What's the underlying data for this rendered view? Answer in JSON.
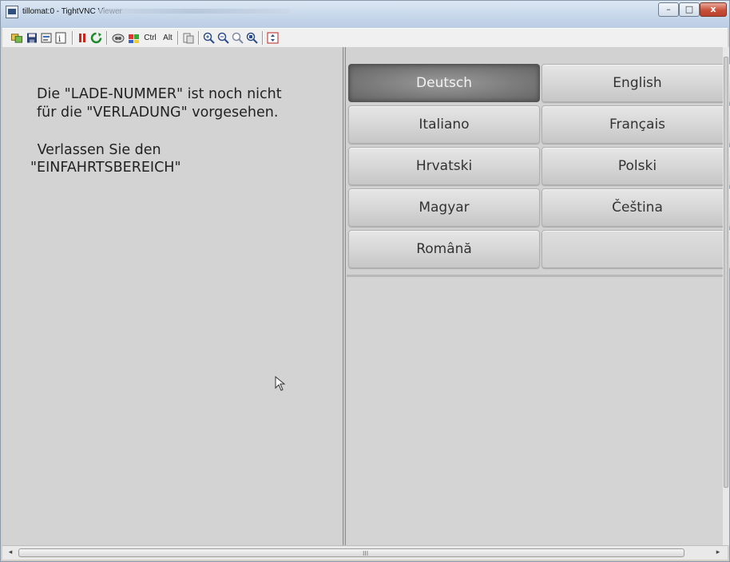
{
  "window": {
    "title": "tillomat:0 - TightVNC Viewer",
    "minimize_glyph": "–",
    "maximize_glyph": "□",
    "close_glyph": "x"
  },
  "toolbar": {
    "ctrl_label": "Ctrl",
    "alt_label": "Alt"
  },
  "message": {
    "line1": "Die \"LADE-NUMMER\" ist noch nicht",
    "line2": "für die \"VERLADUNG\" vorgesehen.",
    "line3": " Verlassen Sie den",
    "line4": "\"EINFAHRTSBEREICH\""
  },
  "languages": [
    {
      "label": "Deutsch",
      "selected": true
    },
    {
      "label": "English",
      "selected": false
    },
    {
      "label": "Italiano",
      "selected": false
    },
    {
      "label": "Français",
      "selected": false
    },
    {
      "label": "Hrvatski",
      "selected": false
    },
    {
      "label": "Polski",
      "selected": false
    },
    {
      "label": "Magyar",
      "selected": false
    },
    {
      "label": "Čeština",
      "selected": false
    },
    {
      "label": "Română",
      "selected": false
    },
    {
      "label": "",
      "selected": false
    }
  ],
  "scrollbar": {
    "left_arrow": "◂",
    "right_arrow": "▸",
    "grip": "III"
  },
  "colors": {
    "selected_button": "#7b7b7b",
    "button": "#d7d7d7",
    "panel": "#d3d3d3",
    "title_bar": "#c5d6ea",
    "close_button": "#c8503a"
  }
}
